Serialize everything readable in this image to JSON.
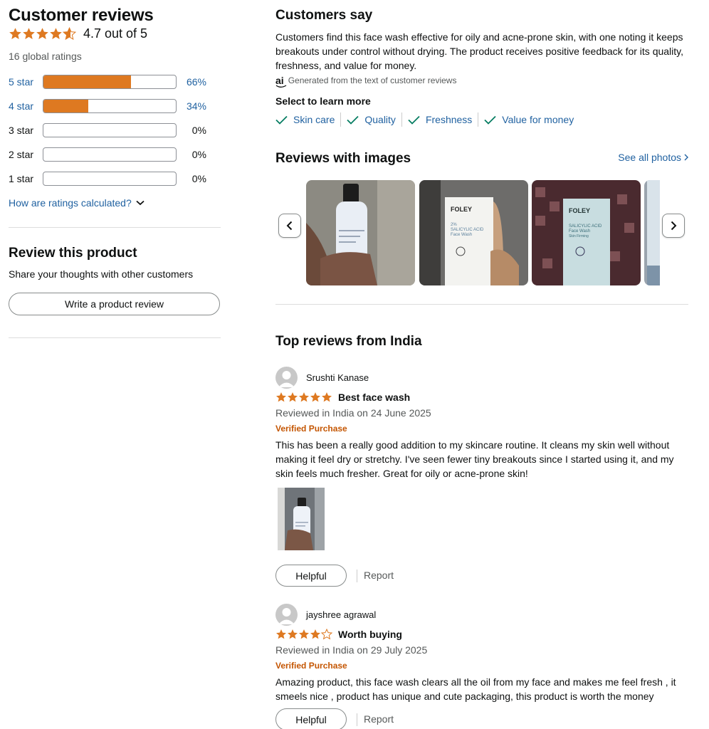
{
  "summary": {
    "title": "Customer reviews",
    "rating": 4.7,
    "rating_text": "4.7 out of 5",
    "global_ratings": "16 global ratings",
    "histogram": [
      {
        "label": "5 star",
        "percent_text": "66%",
        "fraction": 0.66,
        "link": true
      },
      {
        "label": "4 star",
        "percent_text": "34%",
        "fraction": 0.34,
        "link": true
      },
      {
        "label": "3 star",
        "percent_text": "0%",
        "fraction": 0,
        "link": false
      },
      {
        "label": "2 star",
        "percent_text": "0%",
        "fraction": 0,
        "link": false
      },
      {
        "label": "1 star",
        "percent_text": "0%",
        "fraction": 0,
        "link": false
      }
    ],
    "how_calculated": "How are ratings calculated?"
  },
  "review_product": {
    "title": "Review this product",
    "subtitle": "Share your thoughts with other customers",
    "button": "Write a product review"
  },
  "customers_say": {
    "title": "Customers say",
    "body": "Customers find this face wash effective for oily and acne-prone skin, with one noting it keeps breakouts under control without drying. The product receives positive feedback for its quality, freshness, and value for money.",
    "ai_badge": "ai",
    "ai_note": "Generated from the text of customer reviews",
    "select_more": "Select to learn more",
    "aspects": [
      "Skin care",
      "Quality",
      "Freshness",
      "Value for money"
    ]
  },
  "reviews_with_images": {
    "title": "Reviews with images",
    "see_all": "See all photos"
  },
  "top_reviews": {
    "title": "Top reviews from India",
    "reviews": [
      {
        "author": "Srushti Kanase",
        "stars": 5,
        "title": "Best face wash",
        "date": "Reviewed in India on 24 June 2025",
        "verified": "Verified Purchase",
        "body": "This has been a really good addition to my skincare routine. It cleans my skin well without making it feel dry or stretchy. I've seen fewer tiny breakouts since I started using it, and my skin feels much fresher. Great for oily or acne-prone skin!",
        "helpful": "Helpful",
        "report": "Report"
      },
      {
        "author": "jayshree agrawal",
        "stars": 4,
        "title": "Worth buying",
        "date": "Reviewed in India on 29 July 2025",
        "verified": "Verified Purchase",
        "body": "Amazing product, this face wash clears all the oil from my face and makes me feel fresh , it smeels nice , product has unique and cute packaging, this product is worth the money",
        "helpful": "Helpful",
        "report": "Report"
      }
    ]
  },
  "product_labels": {
    "brand": "FOLEY",
    "percent": "2%",
    "ingredient": "SALICYLIC ACID",
    "product": "Face Wash",
    "note": "Skin Firming"
  },
  "colors": {
    "star": "#de7921",
    "link": "#2162a1",
    "verified": "#c45500",
    "check": "#067d62"
  }
}
